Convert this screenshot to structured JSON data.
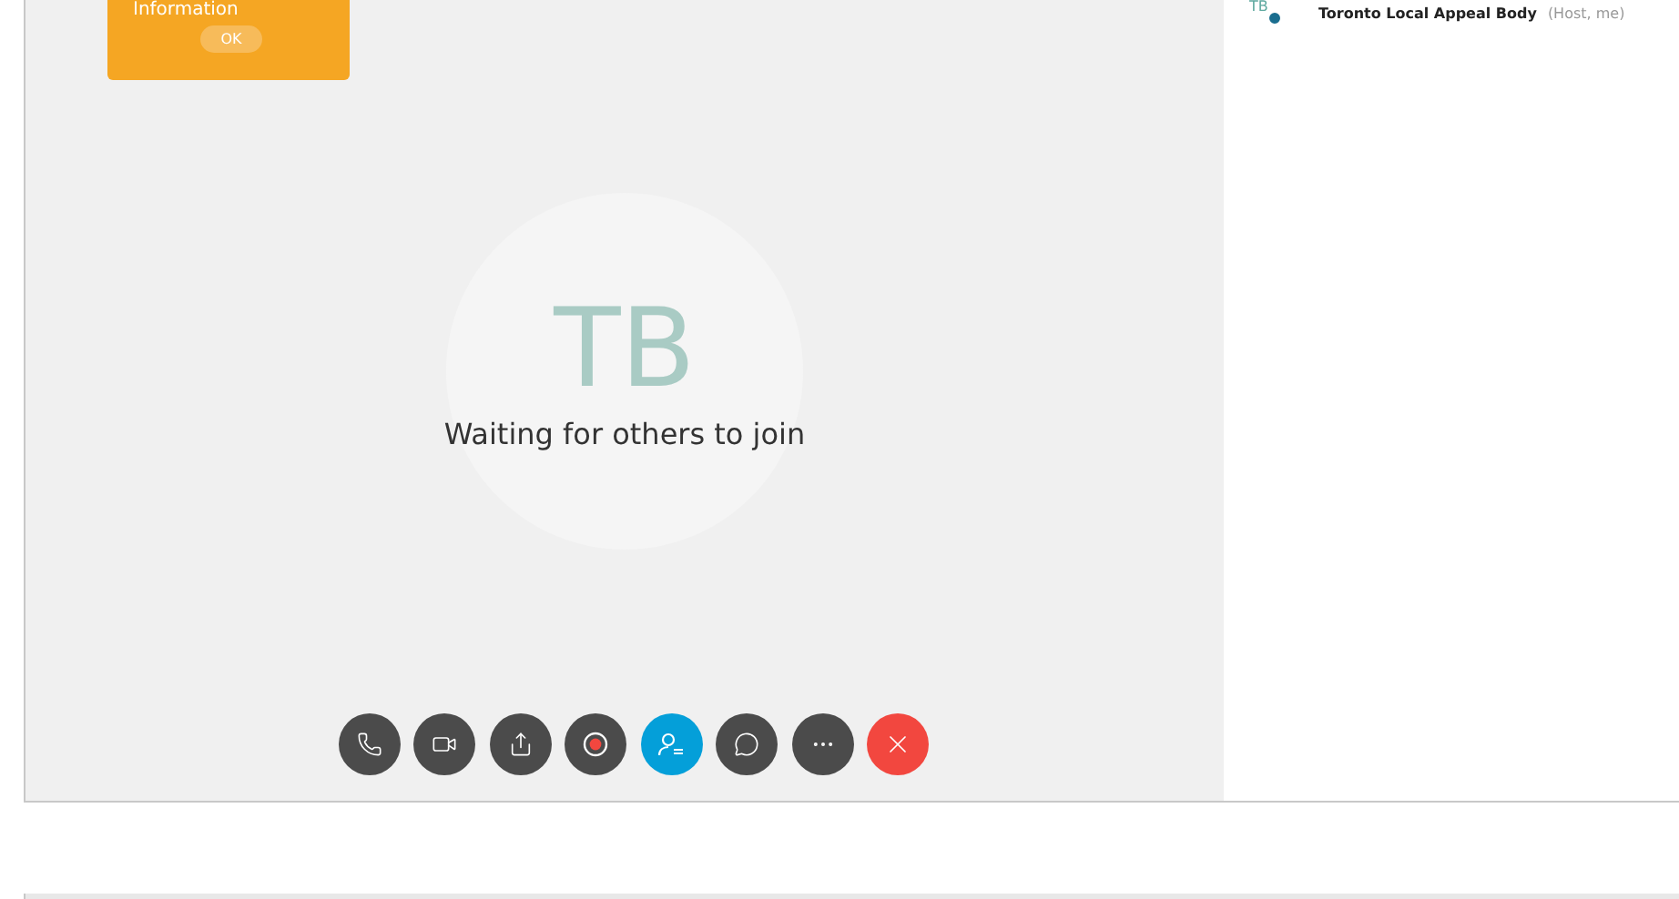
{
  "notification": {
    "message": "Information",
    "button": "OK"
  },
  "stage": {
    "avatar_initials": "TB",
    "status": "Waiting for others to join"
  },
  "controls": [
    {
      "kind": "audio",
      "selected": false
    },
    {
      "kind": "video",
      "selected": false
    },
    {
      "kind": "share",
      "selected": false
    },
    {
      "kind": "record",
      "selected": false
    },
    {
      "kind": "participants",
      "selected": true
    },
    {
      "kind": "chat",
      "selected": false
    },
    {
      "kind": "more",
      "selected": false
    },
    {
      "kind": "leave",
      "selected": false
    }
  ],
  "participants": [
    {
      "initials": "TB",
      "name": "Toronto Local Appeal Body",
      "role": "(Host, me)"
    }
  ]
}
